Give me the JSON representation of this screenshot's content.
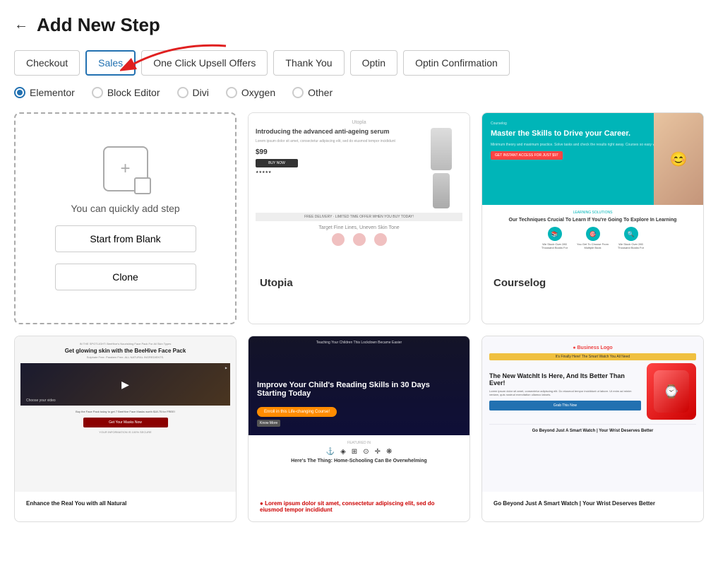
{
  "header": {
    "back_label": "←",
    "title": "Add New Step"
  },
  "tabs": [
    {
      "id": "checkout",
      "label": "Checkout",
      "active": false
    },
    {
      "id": "sales",
      "label": "Sales",
      "active": true
    },
    {
      "id": "one_click",
      "label": "One Click Upsell Offers",
      "active": false
    },
    {
      "id": "thank_you",
      "label": "Thank You",
      "active": false
    },
    {
      "id": "optin",
      "label": "Optin",
      "active": false
    },
    {
      "id": "optin_confirmation",
      "label": "Optin Confirmation",
      "active": false
    }
  ],
  "radio_options": [
    {
      "id": "elementor",
      "label": "Elementor",
      "checked": true
    },
    {
      "id": "block_editor",
      "label": "Block Editor",
      "checked": false
    },
    {
      "id": "divi",
      "label": "Divi",
      "checked": false
    },
    {
      "id": "oxygen",
      "label": "Oxygen",
      "checked": false
    },
    {
      "id": "other",
      "label": "Other",
      "checked": false
    }
  ],
  "blank_card": {
    "text": "You can quickly add step",
    "start_blank_label": "Start from Blank",
    "clone_label": "Clone"
  },
  "templates": [
    {
      "id": "utopia",
      "name": "Utopia",
      "preview_type": "utopia"
    },
    {
      "id": "courselog",
      "name": "Courselog",
      "preview_type": "courselog"
    },
    {
      "id": "beehive",
      "name": "",
      "preview_type": "beehive"
    },
    {
      "id": "reading",
      "name": "",
      "preview_type": "reading"
    },
    {
      "id": "watch",
      "name": "",
      "preview_type": "watch"
    }
  ]
}
